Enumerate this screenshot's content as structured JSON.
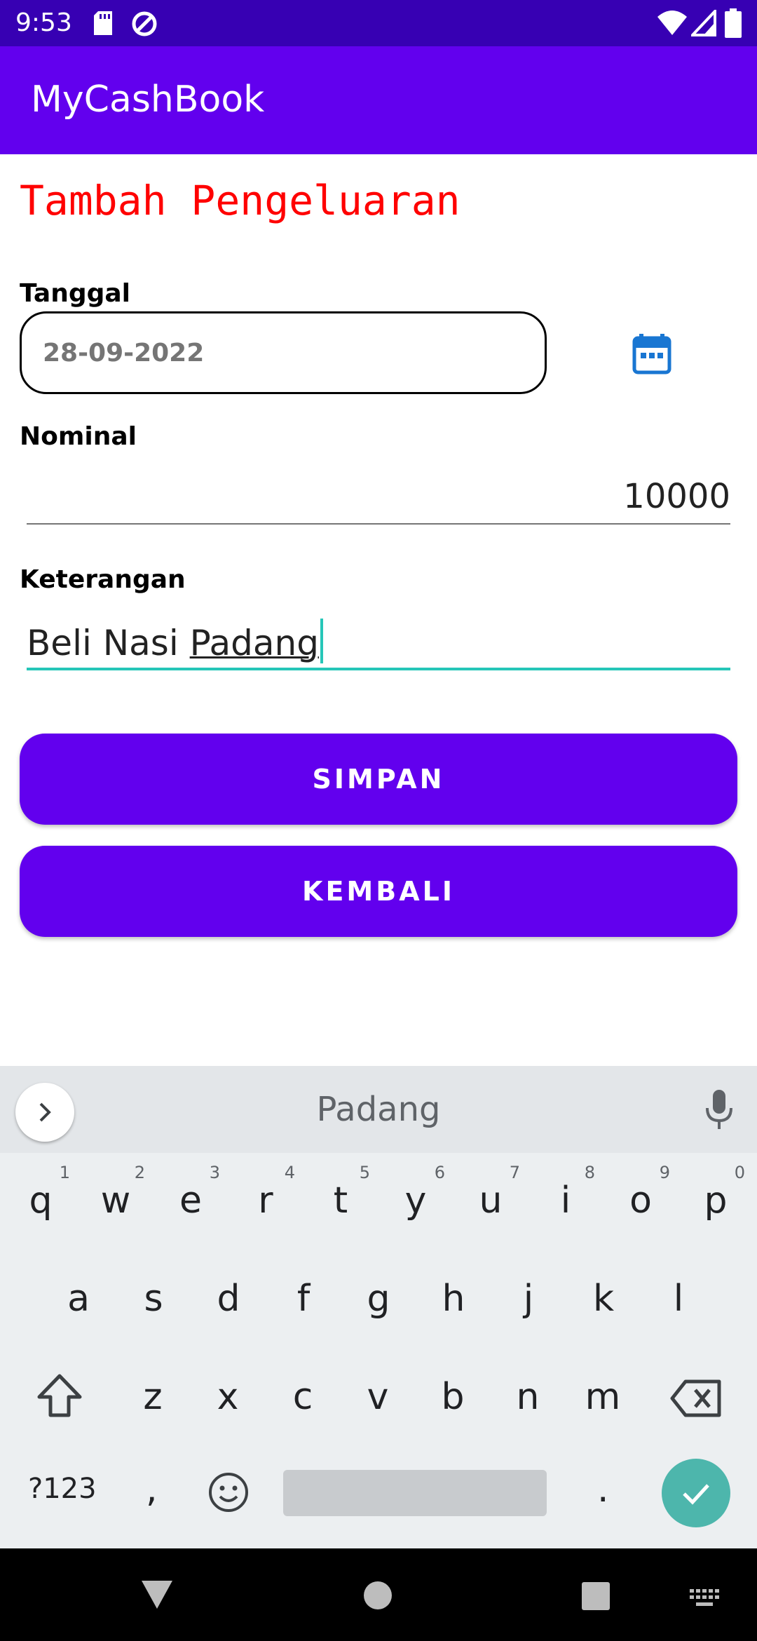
{
  "status_bar": {
    "time": "9:53"
  },
  "app_bar": {
    "title": "MyCashBook"
  },
  "form": {
    "heading": "Tambah Pengeluaran",
    "date_label": "Tanggal",
    "date_value": "28-09-2022",
    "nominal_label": "Nominal",
    "nominal_value": "10000",
    "keterangan_label": "Keterangan",
    "keterangan_prefix": "Beli Nasi ",
    "keterangan_composing": "Padang"
  },
  "buttons": {
    "save": "SIMPAN",
    "back": "KEMBALI"
  },
  "colors": {
    "primary": "#6200ee",
    "primary_dark": "#3700b3",
    "heading": "#ff0000",
    "accent": "#26c6b8",
    "calendar": "#1976d2"
  },
  "keyboard": {
    "suggestion": "Padang",
    "row1": [
      {
        "k": "q",
        "n": "1"
      },
      {
        "k": "w",
        "n": "2"
      },
      {
        "k": "e",
        "n": "3"
      },
      {
        "k": "r",
        "n": "4"
      },
      {
        "k": "t",
        "n": "5"
      },
      {
        "k": "y",
        "n": "6"
      },
      {
        "k": "u",
        "n": "7"
      },
      {
        "k": "i",
        "n": "8"
      },
      {
        "k": "o",
        "n": "9"
      },
      {
        "k": "p",
        "n": "0"
      }
    ],
    "row2": [
      "a",
      "s",
      "d",
      "f",
      "g",
      "h",
      "j",
      "k",
      "l"
    ],
    "row3": [
      "z",
      "x",
      "c",
      "v",
      "b",
      "n",
      "m"
    ],
    "symbols_key": "?123",
    "comma_key": ",",
    "period_key": "."
  }
}
